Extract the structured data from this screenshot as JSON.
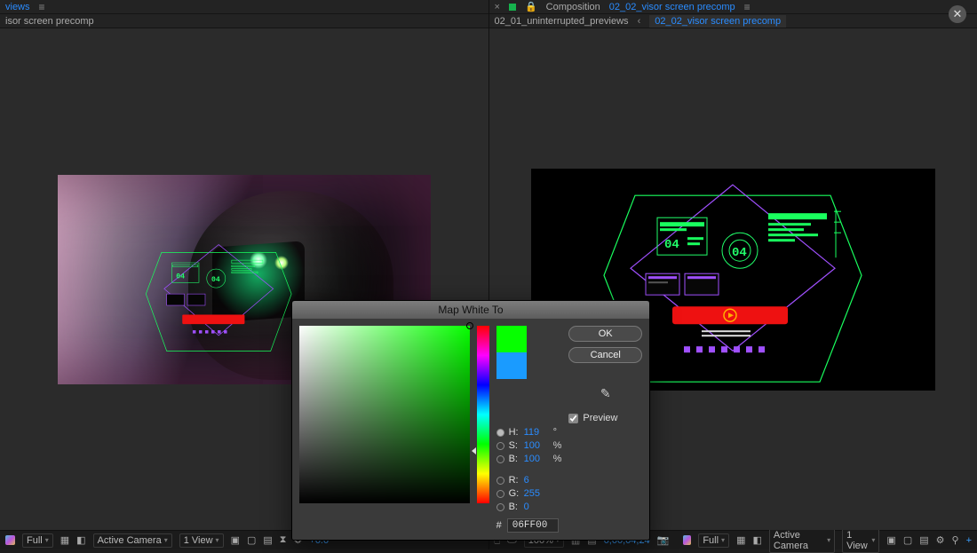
{
  "left_panel": {
    "tab_label": "views",
    "breadcrumb": "isor screen precomp"
  },
  "right_panel": {
    "tab_prefix": "Composition",
    "tab_label": "02_02_visor screen precomp",
    "breadcrumbs": {
      "crumb1": "02_01_uninterrupted_previews",
      "crumb2": "02_02_visor screen precomp"
    }
  },
  "toolbar_left": {
    "mag_label": "Full",
    "camera": "Active Camera",
    "view": "1 View",
    "exposure": "+0.0"
  },
  "toolbar_right": {
    "zoom": "100%",
    "time": "0;00;04;24",
    "mag_label": "Full",
    "camera": "Active Camera",
    "view": "1 View"
  },
  "dialog": {
    "title": "Map White To",
    "ok": "OK",
    "cancel": "Cancel",
    "preview_label": "Preview",
    "fields": {
      "H": {
        "value": "119",
        "suffix": "°"
      },
      "S": {
        "value": "100",
        "suffix": "%"
      },
      "B": {
        "value": "100",
        "suffix": "%"
      },
      "R": {
        "value": "6",
        "suffix": ""
      },
      "G": {
        "value": "255",
        "suffix": ""
      },
      "Bb": {
        "value": "0",
        "suffix": ""
      }
    },
    "hex": "06FF00"
  },
  "hud": {
    "num1": "04",
    "num2": "04"
  }
}
